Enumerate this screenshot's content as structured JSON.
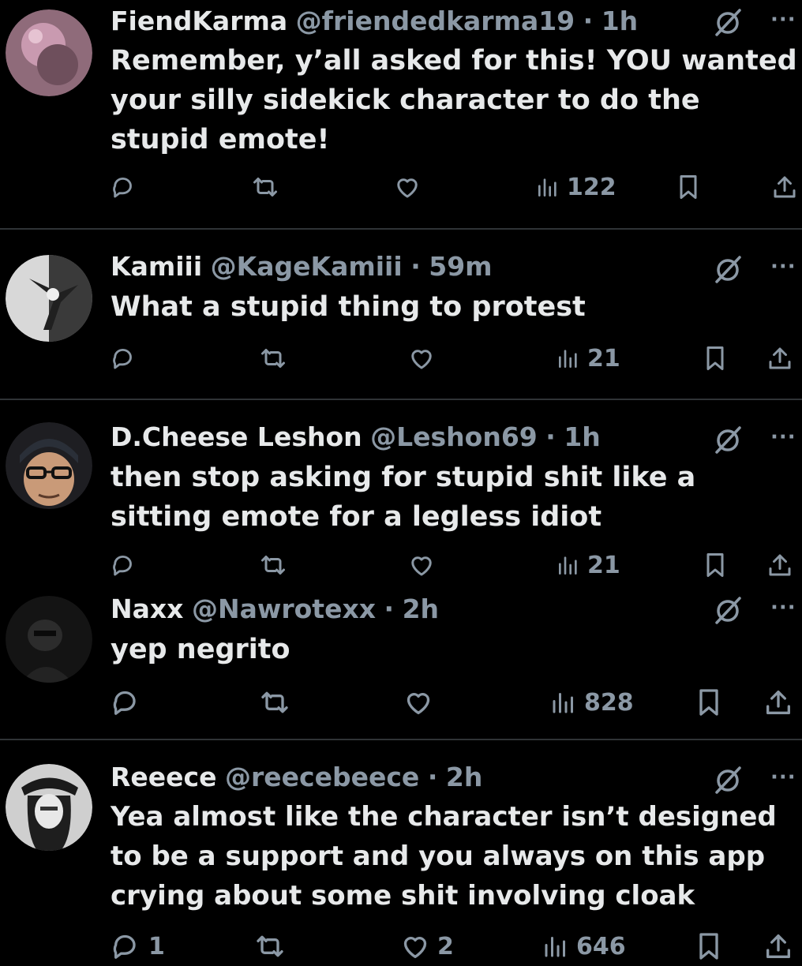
{
  "colors": {
    "background": "#000000",
    "text": "#e7e9ea",
    "muted": "#8b98a5",
    "divider": "#2f3336"
  },
  "icons": {
    "reply": "reply-bubble-icon",
    "repost": "repost-arrows-icon",
    "like": "heart-icon",
    "views": "bar-chart-icon",
    "bookmark": "bookmark-icon",
    "share": "share-upload-icon",
    "grok": "grok-slash-icon",
    "more": "more-ellipsis-icon"
  },
  "posts": [
    {
      "name": "FiendKarma",
      "handle": "@friendedkarma19",
      "sep": "·",
      "time": "1h",
      "more": "···",
      "text": "Remember, y’all asked for this! YOU wanted your silly sidekick character to do the stupid emote!",
      "views": "122",
      "replies": "",
      "likes": ""
    },
    {
      "name": "Kamiii",
      "handle": "@KageKamiii",
      "sep": "·",
      "time": "59m",
      "more": "···",
      "text": "What a stupid thing to protest",
      "views": "21",
      "replies": "",
      "likes": ""
    },
    {
      "name": "D.Cheese Leshon",
      "handle": "@Leshon69",
      "sep": "·",
      "time": "1h",
      "more": "···",
      "text": "then stop asking for stupid shit like a sitting emote for a legless idiot",
      "views": "21",
      "replies": "",
      "likes": ""
    },
    {
      "name": "Naxx",
      "handle": "@Nawrotexx",
      "sep": "·",
      "time": "2h",
      "more": "···",
      "text": "yep negrito",
      "views": "828",
      "replies": "",
      "likes": ""
    },
    {
      "name": "Reeece",
      "handle": "@reecebeece",
      "sep": "·",
      "time": "2h",
      "more": "···",
      "text": "Yea almost like the character isn’t designed to be a support and you always on this app crying about some shit involving cloak",
      "views": "646",
      "replies": "1",
      "likes": "2"
    }
  ]
}
